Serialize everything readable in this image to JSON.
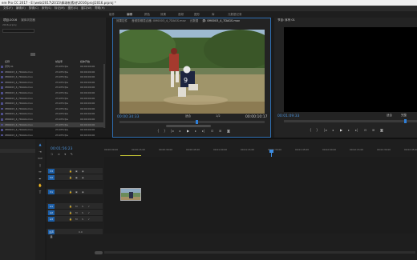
{
  "window": {
    "title": "ere Pro CC 2017 - E:\\web\\2017\\2015\\棒球新素材\\2016\\proj\\2016.prproj *"
  },
  "menu": [
    "文件(F)",
    "编辑(E)",
    "剪辑(C)",
    "序列(S)",
    "标记(M)",
    "图形(G)",
    "窗口(W)",
    "帮助(H)"
  ],
  "workspaces": [
    {
      "label": "组件",
      "active": false
    },
    {
      "label": "编辑",
      "active": true
    },
    {
      "label": "颜色",
      "active": false
    },
    {
      "label": "效果",
      "active": false
    },
    {
      "label": "音频",
      "active": false
    },
    {
      "label": "图形",
      "active": false
    },
    {
      "label": "库",
      "active": false
    },
    {
      "label": "元数据记录",
      "active": false
    }
  ],
  "project_panel": {
    "tabs": [
      "项目:2016",
      "媒体浏览器"
    ],
    "path": "2016.prproj",
    "search_placeholder": "",
    "columns": [
      "名称",
      "帧速率",
      "媒体开始"
    ],
    "rows": [
      {
        "name": "序列 01",
        "fps": "23.976 fps",
        "start": "00:00:00:00",
        "selected": false
      },
      {
        "name": "0M0003_4_7DAGS.mov",
        "fps": "23.976 fps",
        "start": "00:00:00:00",
        "selected": false
      },
      {
        "name": "0M0003_4_7DAGS.mov",
        "fps": "23.976 fps",
        "start": "00:00:00:00",
        "selected": false
      },
      {
        "name": "0M0003_4_7DAGS.mov",
        "fps": "23.976 fps",
        "start": "00:00:00:00",
        "selected": false
      },
      {
        "name": "0M0003_4_7DAGS.mov",
        "fps": "23.976 fps",
        "start": "00:00:00:00",
        "selected": false
      },
      {
        "name": "0M0003_4_7DAGS.mov",
        "fps": "23.976 fps",
        "start": "00:00:00:00",
        "selected": false
      },
      {
        "name": "0M0003_4_7DAGS.mov",
        "fps": "23.976 fps",
        "start": "00:00:00:00",
        "selected": false
      },
      {
        "name": "0M0003_4_7DAGS.mov",
        "fps": "23.976 fps",
        "start": "00:00:00:00",
        "selected": false
      },
      {
        "name": "0M0003_4_7DAGS.mov",
        "fps": "23.976 fps",
        "start": "00:00:00:00",
        "selected": false
      },
      {
        "name": "0M0003_4_7DAGS.mov",
        "fps": "23.976 fps",
        "start": "00:00:00:00",
        "selected": false
      },
      {
        "name": "0M0003_4_7DAGS.mov",
        "fps": "23.976 fps",
        "start": "00:00:00:00",
        "selected": false
      },
      {
        "name": "0M0003_4_7DAGS.mov",
        "fps": "23.976 fps",
        "start": "00:00:00:00",
        "selected": true
      },
      {
        "name": "0M0003_4_7DAGS.mov",
        "fps": "23.976 fps",
        "start": "00:00:00:00",
        "selected": false
      },
      {
        "name": "0M0003_4_7DAGS.mov",
        "fps": "23.976 fps",
        "start": "00:00:00:00",
        "selected": false
      },
      {
        "name": "0M0003_4_7DAGS.mov",
        "fps": "23.976 fps",
        "start": "00:00:00:00",
        "selected": false
      }
    ]
  },
  "source_panel": {
    "tabs": [
      "效果控件",
      "音频剪辑混合器: 0M0003_4_7DAGS.mov",
      "元数据",
      "源: 0M0003_4_7DAGS.mov"
    ],
    "timecode_in": "00:00:34:33",
    "zoom": "适合",
    "ratio": "1/2",
    "timecode_dur": "00:00:10:17"
  },
  "program_panel": {
    "tab": "节目: 序列 01",
    "timecode": "00:01:09:33",
    "zoom": "适合",
    "ratio": "完整",
    "duration": "00:01:16:24"
  },
  "timeline": {
    "timecode": "00:01:56:23",
    "ruler": [
      "00:00:00:00",
      "00:00:15:00",
      "00:00:30:00",
      "00:00:45:00",
      "00:01:00:00",
      "00:01:15:00",
      "00:01:30:00",
      "00:01:45:00",
      "00:02:00:00",
      "00:02:15:00",
      "00:02:30:00",
      "00:02:45:00"
    ],
    "tracks": [
      {
        "name": "V3",
        "kind": "video"
      },
      {
        "name": "V2",
        "kind": "video"
      },
      {
        "name": "V1",
        "kind": "video"
      },
      {
        "name": "A1",
        "kind": "audio"
      },
      {
        "name": "A2",
        "kind": "audio"
      },
      {
        "name": "A3",
        "kind": "audio"
      },
      {
        "name": "主声道",
        "kind": "master",
        "value": "0.0"
      }
    ]
  },
  "tools": [
    "selection",
    "track-select",
    "ripple-edit",
    "razor",
    "slip",
    "pen",
    "hand",
    "type"
  ]
}
